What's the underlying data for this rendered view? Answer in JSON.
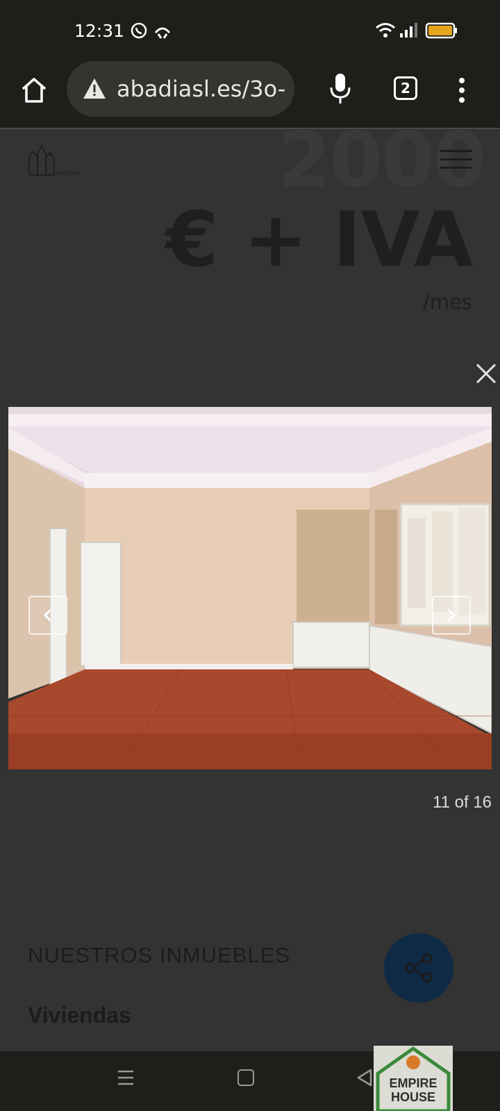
{
  "status_bar": {
    "time": "12:31"
  },
  "browser": {
    "url": "abadiasl.es/3o-",
    "tab_count": "2"
  },
  "site": {
    "logo_text": "ABADIA"
  },
  "listing": {
    "price_text": "€ + IVA",
    "period": "/mes"
  },
  "gallery": {
    "counter": "11 of 16"
  },
  "section": {
    "title": "NUESTROS INMUEBLES",
    "subtitle": "Viviendas"
  },
  "badge": {
    "line1": "EMPIRE",
    "line2": "HOUSE"
  },
  "colors": {
    "chrome_bg": "#1e1f1a",
    "page_overlay": "#333333",
    "share_fab": "#0e2a45"
  }
}
